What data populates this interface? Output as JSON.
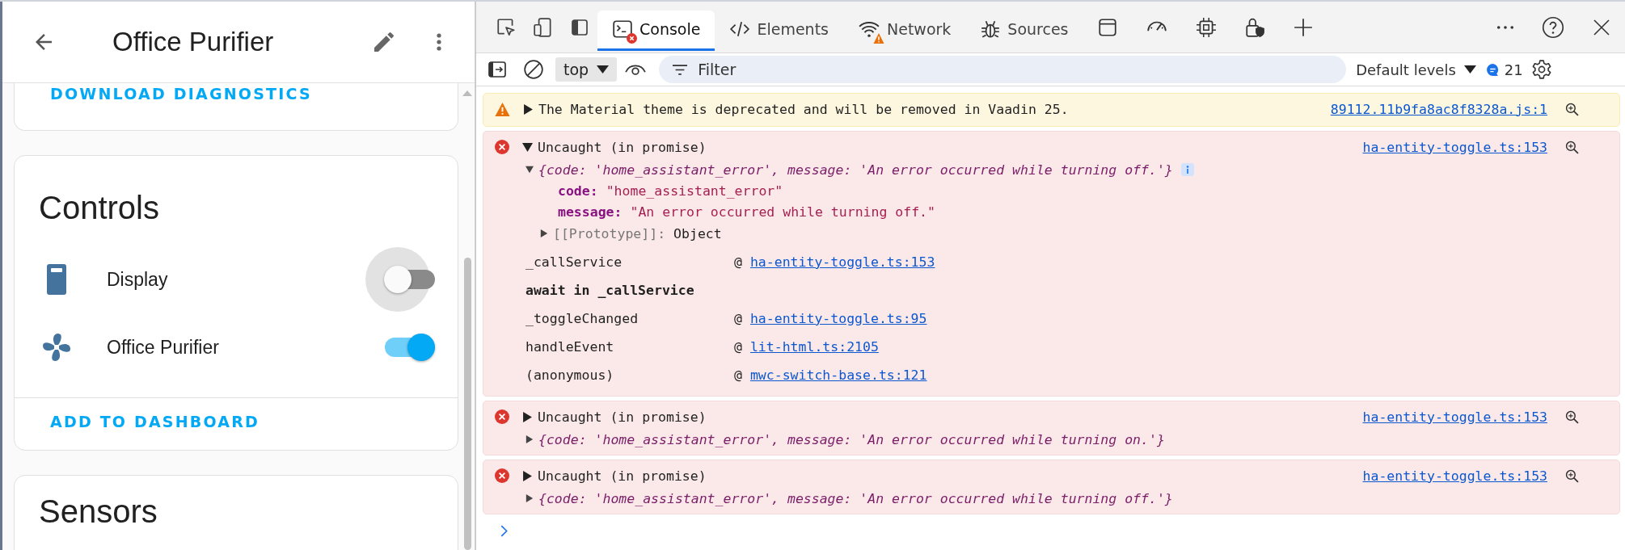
{
  "device_page": {
    "title": "Office Purifier",
    "diagnostics_button": "DOWNLOAD DIAGNOSTICS",
    "controls": {
      "heading": "Controls",
      "entities": [
        {
          "kind": "display",
          "name": "Display",
          "on": false,
          "focused": true
        },
        {
          "kind": "fan",
          "name": "Office Purifier",
          "on": true,
          "focused": false
        }
      ],
      "add_button": "ADD TO DASHBOARD"
    },
    "sensors": {
      "heading": "Sensors"
    }
  },
  "devtools": {
    "tabs": [
      {
        "kind": "console",
        "label": "Console",
        "selected": true,
        "error_badge": true,
        "warning_badge": false
      },
      {
        "kind": "elements",
        "label": "Elements",
        "selected": false,
        "error_badge": false,
        "warning_badge": false
      },
      {
        "kind": "network",
        "label": "Network",
        "selected": false,
        "error_badge": false,
        "warning_badge": true
      },
      {
        "kind": "sources",
        "label": "Sources",
        "selected": false,
        "error_badge": false,
        "warning_badge": false
      }
    ],
    "context": "top",
    "filter": {
      "placeholder": "Filter"
    },
    "levels": "Default levels",
    "message_count": "21",
    "messages": [
      {
        "kind": "warning",
        "expanded": false,
        "text": "The Material theme is deprecated and will be removed in Vaadin 25.",
        "source": "89112.11b9fa8ac8f8328a.js:1"
      },
      {
        "kind": "error",
        "expanded": true,
        "text": "Uncaught (in promise)",
        "source": "ha-entity-toggle.ts:153",
        "object": {
          "expanded": true,
          "preview": "{code: 'home_assistant_error', message: 'An error occurred while turning off.'}",
          "properties": [
            {
              "key": "code:",
              "value": "\"home_assistant_error\""
            },
            {
              "key": "message:",
              "value": "\"An error occurred while turning off.\""
            }
          ],
          "prototype": {
            "key": "[[Prototype]]:",
            "value": "Object",
            "expanded": false
          }
        },
        "stack": [
          {
            "kind": "frame",
            "function": "_callService",
            "at": "@",
            "location": "ha-entity-toggle.ts:153"
          },
          {
            "kind": "async",
            "function": "await in _callService"
          },
          {
            "kind": "frame",
            "function": "_toggleChanged",
            "at": "@",
            "location": "ha-entity-toggle.ts:95"
          },
          {
            "kind": "frame",
            "function": "handleEvent",
            "at": "@",
            "location": "lit-html.ts:2105"
          },
          {
            "kind": "frame",
            "function": "(anonymous)",
            "at": "@",
            "location": "mwc-switch-base.ts:121"
          }
        ]
      },
      {
        "kind": "error",
        "expanded": false,
        "text": "Uncaught (in promise)",
        "source": "ha-entity-toggle.ts:153",
        "object": {
          "expanded": false,
          "preview": "{code: 'home_assistant_error', message: 'An error occurred while turning on.'}"
        }
      },
      {
        "kind": "error",
        "expanded": false,
        "text": "Uncaught (in promise)",
        "source": "ha-entity-toggle.ts:153",
        "object": {
          "expanded": false,
          "preview": "{code: 'home_assistant_error', message: 'An error occurred while turning off.'}"
        }
      }
    ]
  }
}
